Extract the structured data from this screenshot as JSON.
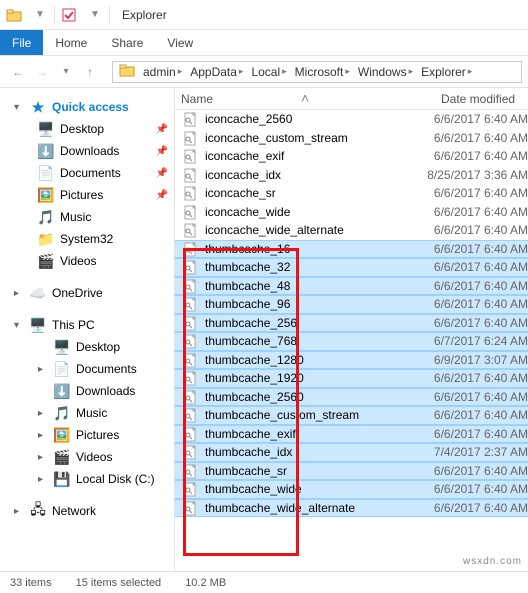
{
  "window_title": "Explorer",
  "ribbon": {
    "file": "File",
    "home": "Home",
    "share": "Share",
    "view": "View"
  },
  "crumbs": [
    "admin",
    "AppData",
    "Local",
    "Microsoft",
    "Windows",
    "Explorer"
  ],
  "columns": {
    "name": "Name",
    "date": "Date modified"
  },
  "nav": {
    "quick_access": "Quick access",
    "desktop": "Desktop",
    "downloads": "Downloads",
    "documents": "Documents",
    "pictures": "Pictures",
    "music": "Music",
    "system32": "System32",
    "videos": "Videos",
    "onedrive": "OneDrive",
    "thispc": "This PC",
    "pc_desktop": "Desktop",
    "pc_documents": "Documents",
    "pc_downloads": "Downloads",
    "pc_music": "Music",
    "pc_pictures": "Pictures",
    "pc_videos": "Videos",
    "local_disk": "Local Disk (C:)",
    "network": "Network"
  },
  "files": [
    {
      "name": "iconcache_2560",
      "date": "6/6/2017 6:40 AM",
      "sel": false
    },
    {
      "name": "iconcache_custom_stream",
      "date": "6/6/2017 6:40 AM",
      "sel": false
    },
    {
      "name": "iconcache_exif",
      "date": "6/6/2017 6:40 AM",
      "sel": false
    },
    {
      "name": "iconcache_idx",
      "date": "8/25/2017 3:36 AM",
      "sel": false
    },
    {
      "name": "iconcache_sr",
      "date": "6/6/2017 6:40 AM",
      "sel": false
    },
    {
      "name": "iconcache_wide",
      "date": "6/6/2017 6:40 AM",
      "sel": false
    },
    {
      "name": "iconcache_wide_alternate",
      "date": "6/6/2017 6:40 AM",
      "sel": false
    },
    {
      "name": "thumbcache_16",
      "date": "6/6/2017 6:40 AM",
      "sel": true
    },
    {
      "name": "thumbcache_32",
      "date": "6/6/2017 6:40 AM",
      "sel": true
    },
    {
      "name": "thumbcache_48",
      "date": "6/6/2017 6:40 AM",
      "sel": true
    },
    {
      "name": "thumbcache_96",
      "date": "6/6/2017 6:40 AM",
      "sel": true
    },
    {
      "name": "thumbcache_256",
      "date": "6/6/2017 6:40 AM",
      "sel": true
    },
    {
      "name": "thumbcache_768",
      "date": "6/7/2017 6:24 AM",
      "sel": true
    },
    {
      "name": "thumbcache_1280",
      "date": "6/9/2017 3:07 AM",
      "sel": true
    },
    {
      "name": "thumbcache_1920",
      "date": "6/6/2017 6:40 AM",
      "sel": true
    },
    {
      "name": "thumbcache_2560",
      "date": "6/6/2017 6:40 AM",
      "sel": true
    },
    {
      "name": "thumbcache_custom_stream",
      "date": "6/6/2017 6:40 AM",
      "sel": true
    },
    {
      "name": "thumbcache_exif",
      "date": "6/6/2017 6:40 AM",
      "sel": true
    },
    {
      "name": "thumbcache_idx",
      "date": "7/4/2017 2:37 AM",
      "sel": true
    },
    {
      "name": "thumbcache_sr",
      "date": "6/6/2017 6:40 AM",
      "sel": true
    },
    {
      "name": "thumbcache_wide",
      "date": "6/6/2017 6:40 AM",
      "sel": true
    },
    {
      "name": "thumbcache_wide_alternate",
      "date": "6/6/2017 6:40 AM",
      "sel": true
    }
  ],
  "status": {
    "total": "33 items",
    "sel": "15 items selected",
    "size": "10.2 MB"
  },
  "watermark": "wsxdn.com"
}
